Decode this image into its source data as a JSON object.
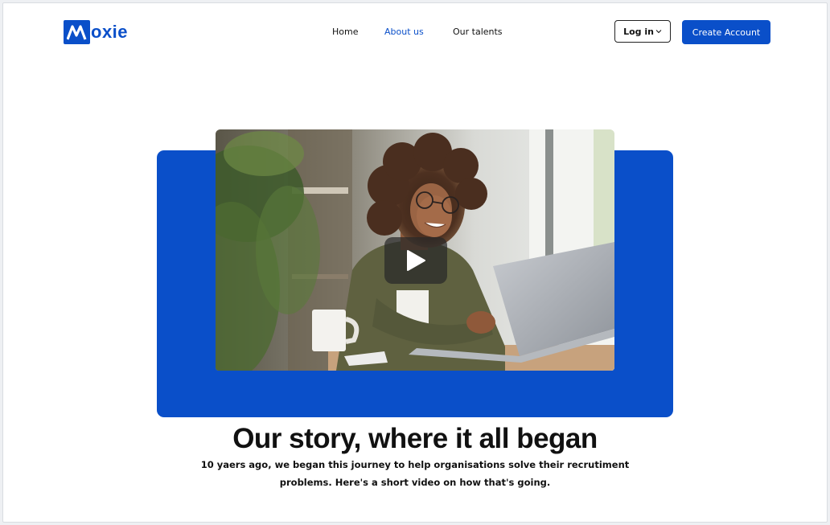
{
  "brand": {
    "name": "Moxie",
    "mark_letter": "M",
    "text_rest": "oxie",
    "color": "#0a4fc9"
  },
  "nav": {
    "items": [
      {
        "label": "Home",
        "active": false
      },
      {
        "label": "About us",
        "active": true
      },
      {
        "label": "Our talents",
        "active": false
      }
    ]
  },
  "actions": {
    "login_label": "Log in",
    "create_label": "Create Account"
  },
  "hero": {
    "video_alt": "Smiling woman with curly hair and glasses working on a laptop",
    "play_icon": "play-icon"
  },
  "story": {
    "heading": "Our story, where it all began",
    "body": "10 yaers ago, we began this journey to help organisations solve their recrutiment problems. Here's a short video on how that's going."
  },
  "colors": {
    "accent": "#0a4fc9",
    "text": "#111111",
    "background": "#ffffff"
  }
}
